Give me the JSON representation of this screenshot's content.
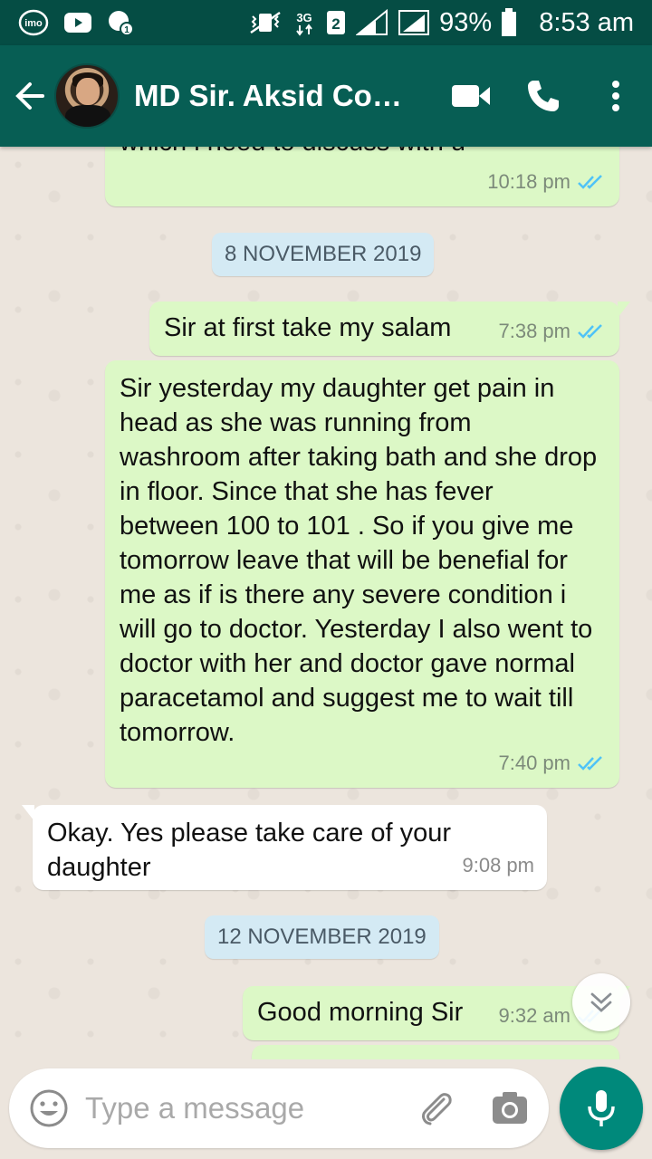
{
  "status_bar": {
    "apps": [
      "imo-icon",
      "youtube-icon",
      "messenger-icon"
    ],
    "network": "3G",
    "sim": "2",
    "battery": "93%",
    "time": "8:53 am"
  },
  "header": {
    "title": "MD Sir. Aksid Co…",
    "accent": "#075e54"
  },
  "messages": [
    {
      "type": "out",
      "text": "which i need to discuss with u",
      "time": "10:18 pm",
      "status": "read"
    },
    {
      "type": "date",
      "text": "8 NOVEMBER 2019"
    },
    {
      "type": "out",
      "text": "Sir at first take my salam",
      "time": "7:38 pm",
      "status": "read"
    },
    {
      "type": "out",
      "text": "Sir yesterday my daughter get pain in head as she was running from washroom after taking bath and she drop in floor. Since that she has fever between 100 to 101 . So if you give me tomorrow leave that will be benefial for me as if is there any severe condition i will go to doctor. Yesterday I also went to doctor with her and doctor gave normal paracetamol and suggest me to wait till tomorrow.",
      "time": "7:40 pm",
      "status": "read"
    },
    {
      "type": "in",
      "text": "Okay. Yes please take care of your daughter",
      "time": "9:08 pm"
    },
    {
      "type": "date",
      "text": "12 NOVEMBER 2019"
    },
    {
      "type": "out",
      "text": "Good morning Sir",
      "time": "9:32 am",
      "status": "read"
    }
  ],
  "composer": {
    "placeholder": "Type a message"
  }
}
